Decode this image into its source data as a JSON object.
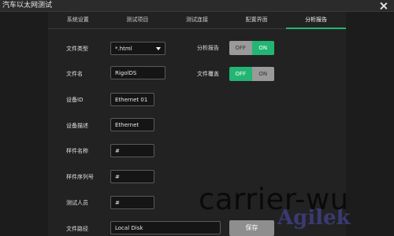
{
  "window": {
    "title": "汽车以太网测试"
  },
  "tabs": [
    {
      "label": "系统设置",
      "active": false
    },
    {
      "label": "测试项目",
      "active": false
    },
    {
      "label": "测试连接",
      "active": false
    },
    {
      "label": "配置界面",
      "active": false
    },
    {
      "label": "分析报告",
      "active": true
    }
  ],
  "form": {
    "file_type": {
      "label": "文件类型",
      "value": "*.html"
    },
    "file_name": {
      "label": "文件名",
      "value": "RigolDS"
    },
    "device_id": {
      "label": "设备ID",
      "value": "Ethernet 01"
    },
    "device_desc": {
      "label": "设备描述",
      "value": "Ethernet"
    },
    "sample_name": {
      "label": "样件名称",
      "value": "#"
    },
    "sample_serial": {
      "label": "样件序列号",
      "value": "#"
    },
    "tester": {
      "label": "测试人员",
      "value": "#"
    },
    "file_path": {
      "label": "文件路径",
      "value": "Local Disk"
    }
  },
  "options": {
    "analysis_report": {
      "label": "分析报告",
      "off_label": "OFF",
      "on_label": "ON",
      "state": "ON"
    },
    "file_overwrite": {
      "label": "文件覆盖",
      "off_label": "OFF",
      "on_label": "ON",
      "state": "OFF"
    }
  },
  "save_label": "保存",
  "overlay": {
    "text": "carrier-wu",
    "watermark": "Agilek"
  },
  "colors": {
    "accent": "#22b573",
    "background": "#1c1c1c",
    "panel": "#222222"
  }
}
